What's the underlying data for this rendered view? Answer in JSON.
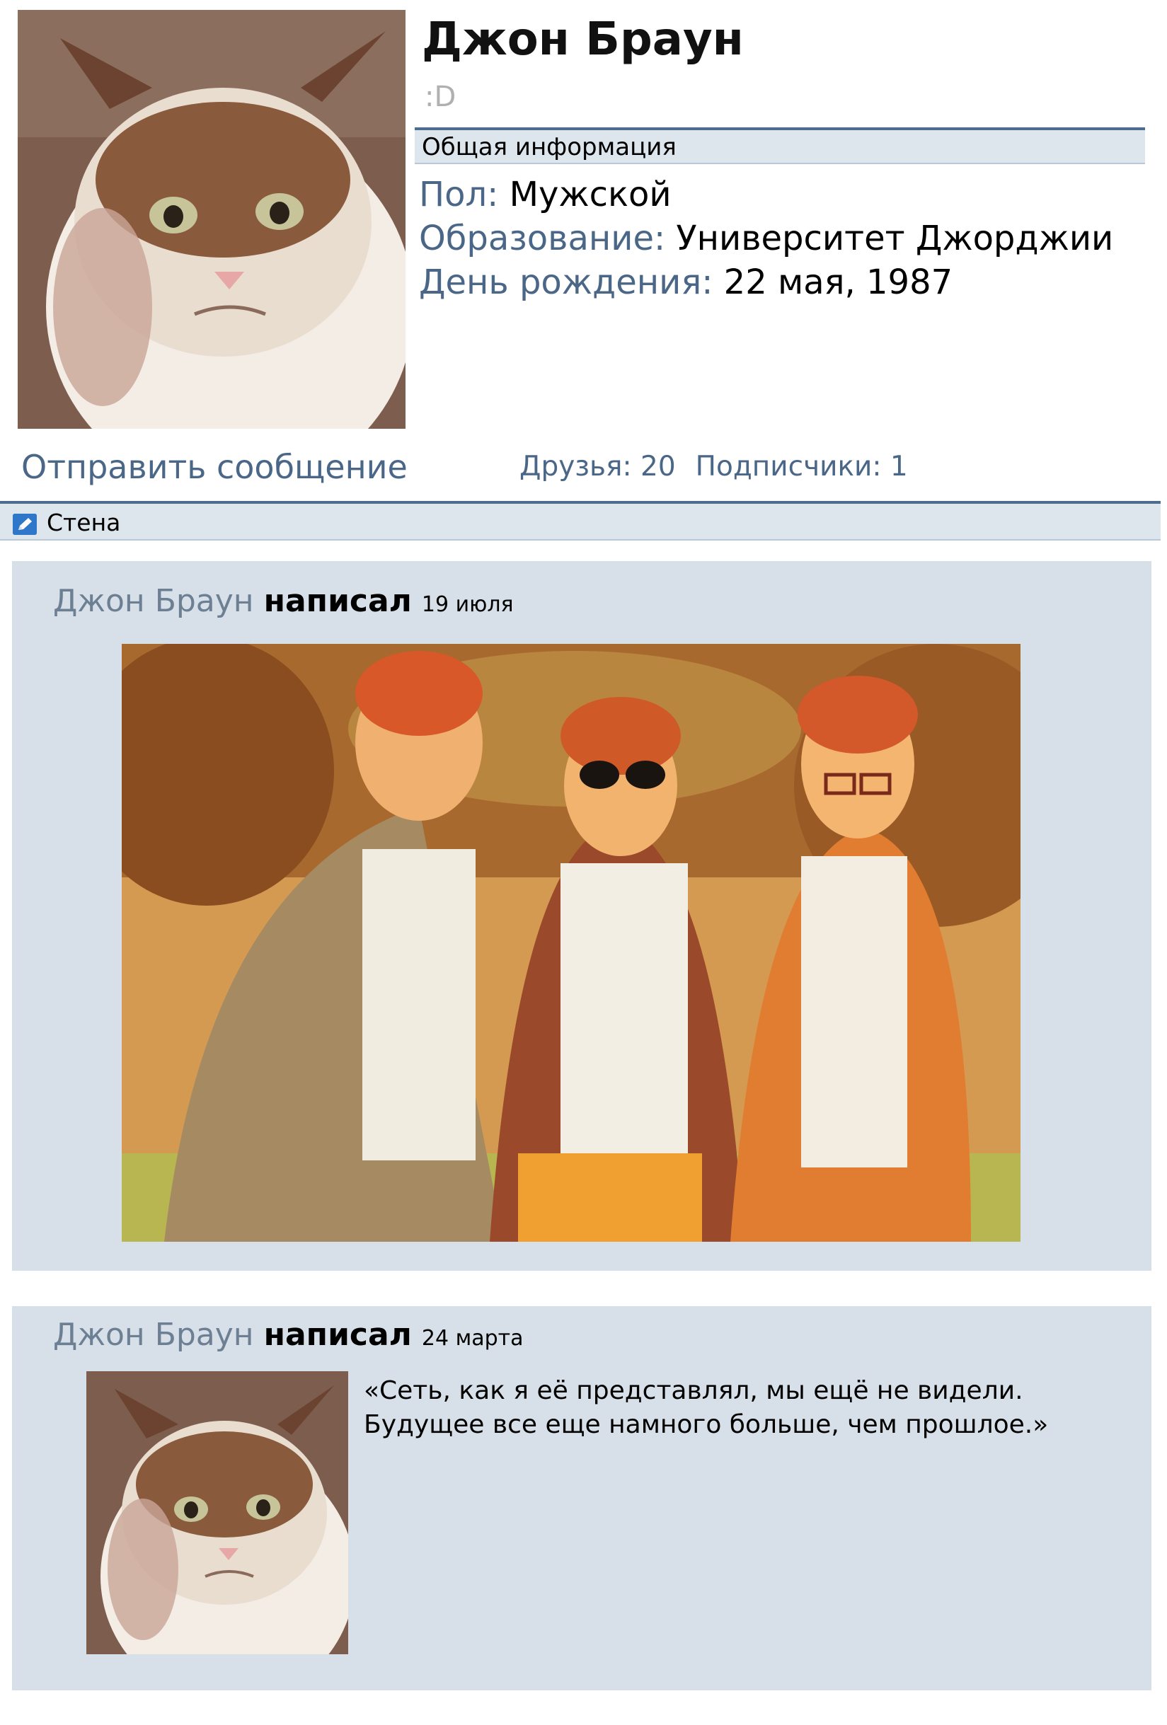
{
  "profile": {
    "name": "Джон Браун",
    "status": ":D",
    "avatar_icon": "grumpy-cat-photo"
  },
  "info_section": {
    "title": "Общая информация",
    "rows": [
      {
        "label": "Пол:",
        "value": "Мужской"
      },
      {
        "label": "Образование:",
        "value": "Университет Джорджии"
      },
      {
        "label": "День рождения:",
        "value": "22 мая, 1987"
      }
    ]
  },
  "actions": {
    "send_message": "Отправить сообщение",
    "friends": "Друзья: 20",
    "followers": "Подписчики: 1"
  },
  "wall": {
    "title": "Стена",
    "icon": "pencil-icon",
    "posts": [
      {
        "author": "Джон Браун",
        "verb": "написал",
        "date": "19 июля",
        "attachment": "group-photo"
      },
      {
        "author": "Джон Браун",
        "verb": "написал",
        "date": "24 марта",
        "attachment": "grumpy-cat-photo",
        "text_line1": "«Сеть, как я её представлял, мы ещё не видели.",
        "text_line2": "Будущее все еще намного больше, чем прошлое.»"
      }
    ]
  },
  "colors": {
    "label_blue": "#4b6788",
    "bar_bg": "#dde5ed",
    "bar_border": "#4d6c8f",
    "post_bg": "#d7e0e9",
    "author_gray": "#6d7f92"
  }
}
